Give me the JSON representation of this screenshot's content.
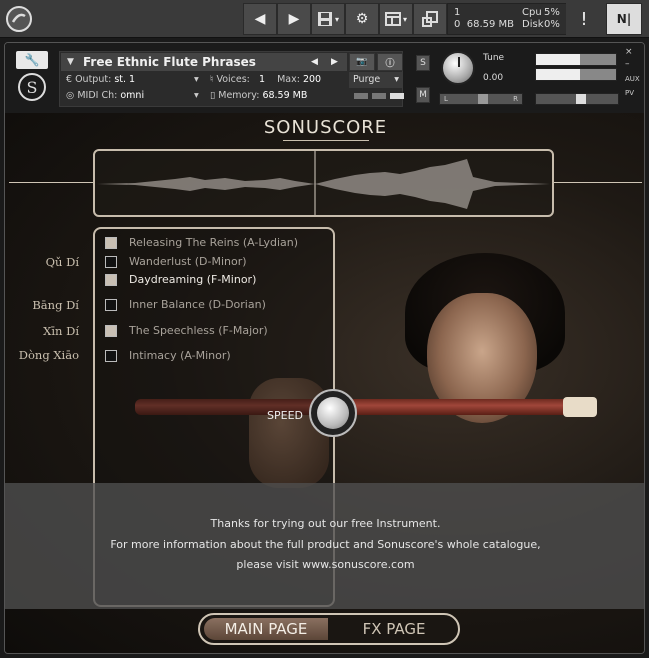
{
  "topbar": {
    "stats": {
      "voices_label": "1",
      "memory": "68.59 MB",
      "cpu_label": "Cpu",
      "cpu_value": "5%",
      "disk_label": "Disk",
      "disk_value": "0%",
      "voices_count": "0"
    },
    "alert_glyph": "!"
  },
  "header": {
    "instrument_name": "Free Ethnic Flute Phrases",
    "output_label": "Output:",
    "output_value": "st. 1",
    "voices_label": "Voices:",
    "voices_value": "1",
    "max_label": "Max:",
    "max_value": "200",
    "purge_label": "Purge",
    "midi_label": "MIDI Ch:",
    "midi_value": "omni",
    "memory_label": "Memory:",
    "memory_value": "68.59 MB",
    "solo_label": "S",
    "mute_label": "M",
    "tune_label": "Tune",
    "tune_value": "0.00",
    "pan_left": "L",
    "pan_right": "R",
    "aux_label": "AUX",
    "pv_label": "PV"
  },
  "brand": "SONUSCORE",
  "flute_labels": [
    "Qǔ Dí",
    "Bāng Dí",
    "Xīn Dí",
    "Dòng Xiāo"
  ],
  "phrases": [
    {
      "label": "Releasing The Reins (A-Lydian)",
      "checked": true
    },
    {
      "label": "Wanderlust (D-Minor)",
      "checked": false
    },
    {
      "label": "Daydreaming (F-Minor)",
      "checked": true,
      "active": true
    },
    {
      "label": "Inner Balance (D-Dorian)",
      "checked": false
    },
    {
      "label": "The Speechless (F-Major)",
      "checked": true
    },
    {
      "label": "Intimacy (A-Minor)",
      "checked": false
    }
  ],
  "speed_label": "SPEED",
  "info": {
    "line1": "Thanks for trying out our free Instrument.",
    "line2": "For more information about the full product and Sonuscore's whole catalogue,",
    "line3": "please visit www.sonuscore.com"
  },
  "tabs": {
    "main": "MAIN PAGE",
    "fx": "FX PAGE"
  }
}
